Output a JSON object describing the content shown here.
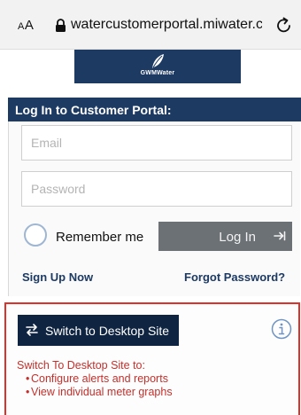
{
  "browser": {
    "text_size_label": "AA",
    "url": "watercustomerportal.miwater.co"
  },
  "logo": {
    "brand_text": "GWMWater"
  },
  "login": {
    "header": "Log In to Customer Portal:",
    "email_placeholder": "Email",
    "password_placeholder": "Password",
    "remember_label": "Remember me",
    "login_label": "Log In",
    "signup_label": "Sign Up Now",
    "forgot_label": "Forgot Password?"
  },
  "desktop": {
    "switch_label": "Switch to Desktop Site",
    "intro": "Switch To Desktop Site to:",
    "items": [
      "Configure alerts and reports",
      "View individual meter graphs"
    ]
  },
  "colors": {
    "navy": "#1d3a63",
    "button_gray": "#6b7175",
    "alert_red": "#e0302a"
  }
}
